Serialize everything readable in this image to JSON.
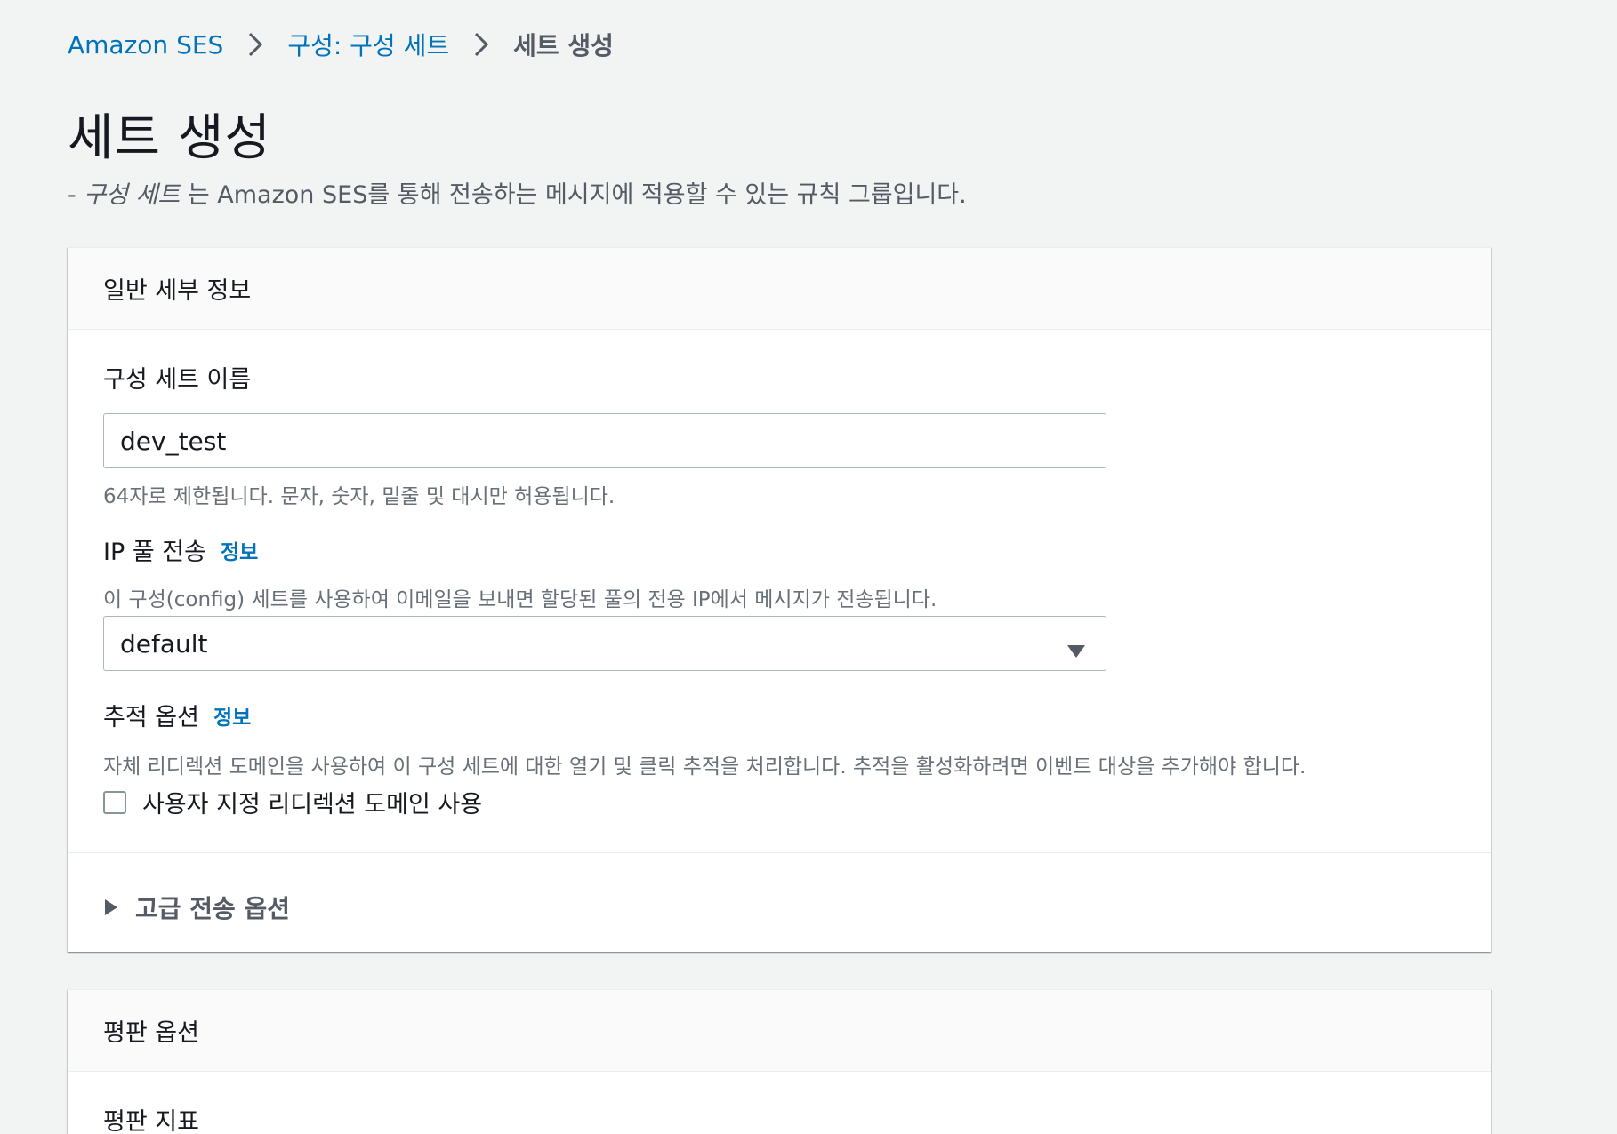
{
  "breadcrumb": {
    "items": [
      {
        "label": "Amazon SES"
      },
      {
        "label": "구성: 구성 세트"
      },
      {
        "label": "세트 생성"
      }
    ]
  },
  "page": {
    "title": "세트 생성",
    "description_prefix": "- ",
    "description_italic": "구성 세트",
    "description_rest": " 는 Amazon SES를 통해 전송하는 메시지에 적용할 수 있는 규칙 그룹입니다."
  },
  "general_panel": {
    "header": "일반 세부 정보",
    "name_field": {
      "label": "구성 세트 이름",
      "value": "dev_test",
      "constraint": "64자로 제한됩니다. 문자, 숫자, 밑줄 및 대시만 허용됩니다."
    },
    "ip_pool": {
      "label": "IP 풀 전송",
      "info": "정보",
      "description": "이 구성(config) 세트를 사용하여 이메일을 보내면 할당된 풀의 전용 IP에서 메시지가 전송됩니다.",
      "selected": "default"
    },
    "tracking": {
      "label": "추적 옵션",
      "info": "정보",
      "description": "자체 리디렉션 도메인을 사용하여 이 구성 세트에 대한 열기 및 클릭 추적을 처리합니다. 추적을 활성화하려면 이벤트 대상을 추가해야 합니다.",
      "checkbox_label": "사용자 지정 리디렉션 도메인 사용"
    },
    "advanced": {
      "label": "고급 전송 옵션"
    }
  },
  "reputation_panel": {
    "header": "평판 옵션",
    "metrics_label": "평판 지표"
  },
  "colors": {
    "link": "#0073bb",
    "background": "#f2f3f3",
    "panel": "#ffffff"
  }
}
